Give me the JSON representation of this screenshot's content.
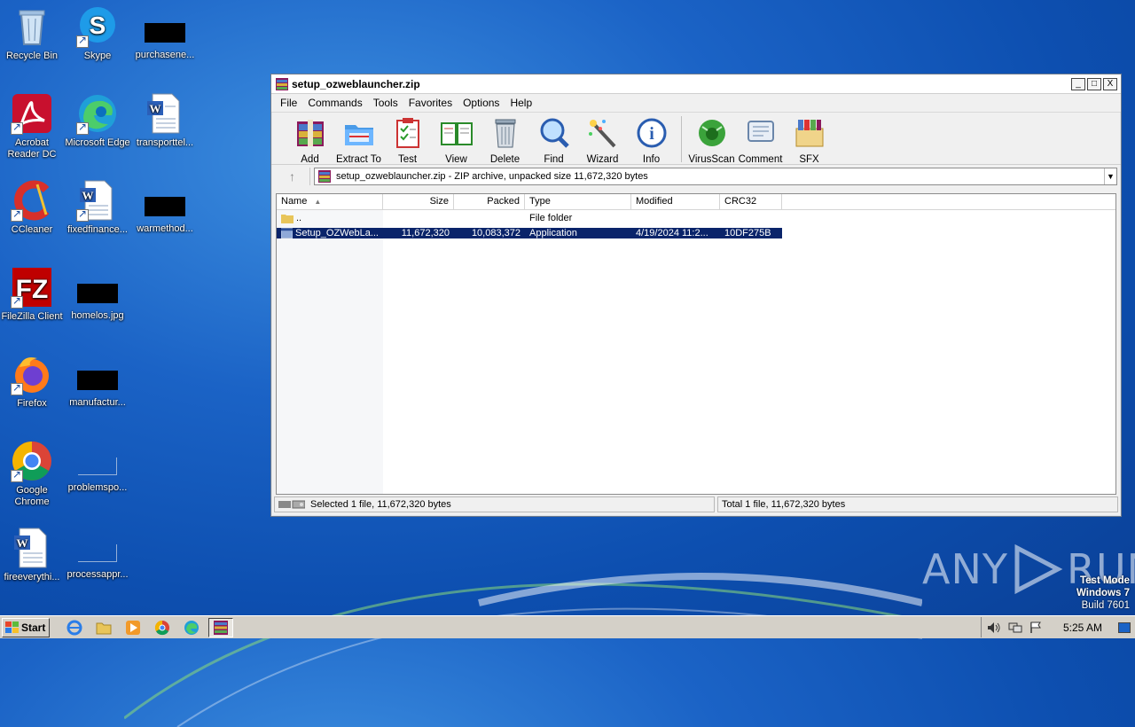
{
  "desktop": {
    "icons": [
      {
        "label": "Recycle Bin"
      },
      {
        "label": "Skype"
      },
      {
        "label": "purchasene..."
      },
      {
        "label": "Acrobat Reader DC"
      },
      {
        "label": "Microsoft Edge"
      },
      {
        "label": "transporttel..."
      },
      {
        "label": "CCleaner"
      },
      {
        "label": "fixedfinance..."
      },
      {
        "label": "warmethod..."
      },
      {
        "label": "FileZilla Client"
      },
      {
        "label": "homelos.jpg"
      },
      {
        "label": "Firefox"
      },
      {
        "label": "manufactur..."
      },
      {
        "label": "Google Chrome"
      },
      {
        "label": "problemspo..."
      },
      {
        "label": "fireeverythi..."
      },
      {
        "label": "processappr..."
      }
    ]
  },
  "window": {
    "title": "setup_ozweblauncher.zip",
    "controls": {
      "minimize": "_",
      "maximize": "□",
      "close": "X"
    },
    "menu": [
      "File",
      "Commands",
      "Tools",
      "Favorites",
      "Options",
      "Help"
    ],
    "toolbar": {
      "add": "Add",
      "extract": "Extract To",
      "test": "Test",
      "view": "View",
      "delete": "Delete",
      "find": "Find",
      "wizard": "Wizard",
      "info": "Info",
      "virusscan": "VirusScan",
      "comment": "Comment",
      "sfx": "SFX"
    },
    "address": {
      "up_glyph": "↑",
      "text": "setup_ozweblauncher.zip - ZIP archive, unpacked size 11,672,320 bytes",
      "dropdown_glyph": "▼"
    },
    "columns": {
      "name": "Name",
      "sort_glyph": "▲",
      "size": "Size",
      "packed": "Packed",
      "type": "Type",
      "modified": "Modified",
      "crc": "CRC32"
    },
    "rows": [
      {
        "name": "..",
        "size": "",
        "packed": "",
        "type": "File folder",
        "modified": "",
        "crc": ""
      },
      {
        "name": "Setup_OZWebLa...",
        "size": "11,672,320",
        "packed": "10,083,372",
        "type": "Application",
        "modified": "4/19/2024 11:2...",
        "crc": "10DF275B"
      }
    ],
    "status": {
      "left": "Selected 1 file, 11,672,320 bytes",
      "right": "Total 1 file, 11,672,320 bytes"
    }
  },
  "watermark": {
    "text_left": "ANY",
    "text_right": "RUN"
  },
  "testmode": {
    "line1": "Test Mode",
    "line2": "Windows 7",
    "line3": "Build 7601"
  },
  "taskbar": {
    "start_label": "Start",
    "clock": "5:25 AM"
  },
  "colors": {
    "selection": "#0a246a",
    "desktop": "#1b63c6",
    "taskbar": "#d4d0c8"
  }
}
